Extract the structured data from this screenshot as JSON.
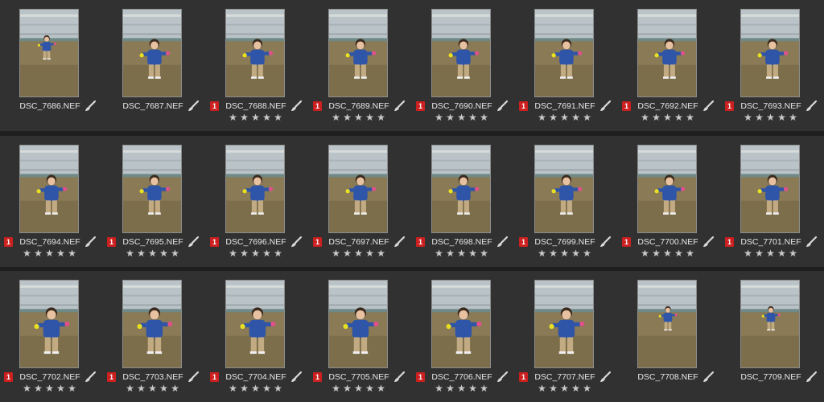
{
  "colors": {
    "background": "#2b2b2b",
    "label_red": "#cc1f1f",
    "star": "#c9c9c9"
  },
  "thumbnails": [
    {
      "filename": "DSC_7686.NEF",
      "label": "",
      "rating": 0,
      "edited": true
    },
    {
      "filename": "DSC_7687.NEF",
      "label": "",
      "rating": 0,
      "edited": true
    },
    {
      "filename": "DSC_7688.NEF",
      "label": "1",
      "rating": 5,
      "edited": true
    },
    {
      "filename": "DSC_7689.NEF",
      "label": "1",
      "rating": 5,
      "edited": true
    },
    {
      "filename": "DSC_7690.NEF",
      "label": "1",
      "rating": 5,
      "edited": true
    },
    {
      "filename": "DSC_7691.NEF",
      "label": "1",
      "rating": 5,
      "edited": true
    },
    {
      "filename": "DSC_7692.NEF",
      "label": "1",
      "rating": 5,
      "edited": true
    },
    {
      "filename": "DSC_7693.NEF",
      "label": "1",
      "rating": 5,
      "edited": true
    },
    {
      "filename": "DSC_7694.NEF",
      "label": "1",
      "rating": 5,
      "edited": true
    },
    {
      "filename": "DSC_7695.NEF",
      "label": "1",
      "rating": 5,
      "edited": true
    },
    {
      "filename": "DSC_7696.NEF",
      "label": "1",
      "rating": 5,
      "edited": true
    },
    {
      "filename": "DSC_7697.NEF",
      "label": "1",
      "rating": 5,
      "edited": true
    },
    {
      "filename": "DSC_7698.NEF",
      "label": "1",
      "rating": 5,
      "edited": true
    },
    {
      "filename": "DSC_7699.NEF",
      "label": "1",
      "rating": 5,
      "edited": true
    },
    {
      "filename": "DSC_7700.NEF",
      "label": "1",
      "rating": 5,
      "edited": true
    },
    {
      "filename": "DSC_7701.NEF",
      "label": "1",
      "rating": 5,
      "edited": true
    },
    {
      "filename": "DSC_7702.NEF",
      "label": "1",
      "rating": 5,
      "edited": true
    },
    {
      "filename": "DSC_7703.NEF",
      "label": "1",
      "rating": 5,
      "edited": true
    },
    {
      "filename": "DSC_7704.NEF",
      "label": "1",
      "rating": 5,
      "edited": true
    },
    {
      "filename": "DSC_7705.NEF",
      "label": "1",
      "rating": 5,
      "edited": true
    },
    {
      "filename": "DSC_7706.NEF",
      "label": "1",
      "rating": 5,
      "edited": true
    },
    {
      "filename": "DSC_7707.NEF",
      "label": "1",
      "rating": 5,
      "edited": true
    },
    {
      "filename": "DSC_7708.NEF",
      "label": "",
      "rating": 0,
      "edited": true
    },
    {
      "filename": "DSC_7709.NEF",
      "label": "",
      "rating": 0,
      "edited": true
    }
  ]
}
